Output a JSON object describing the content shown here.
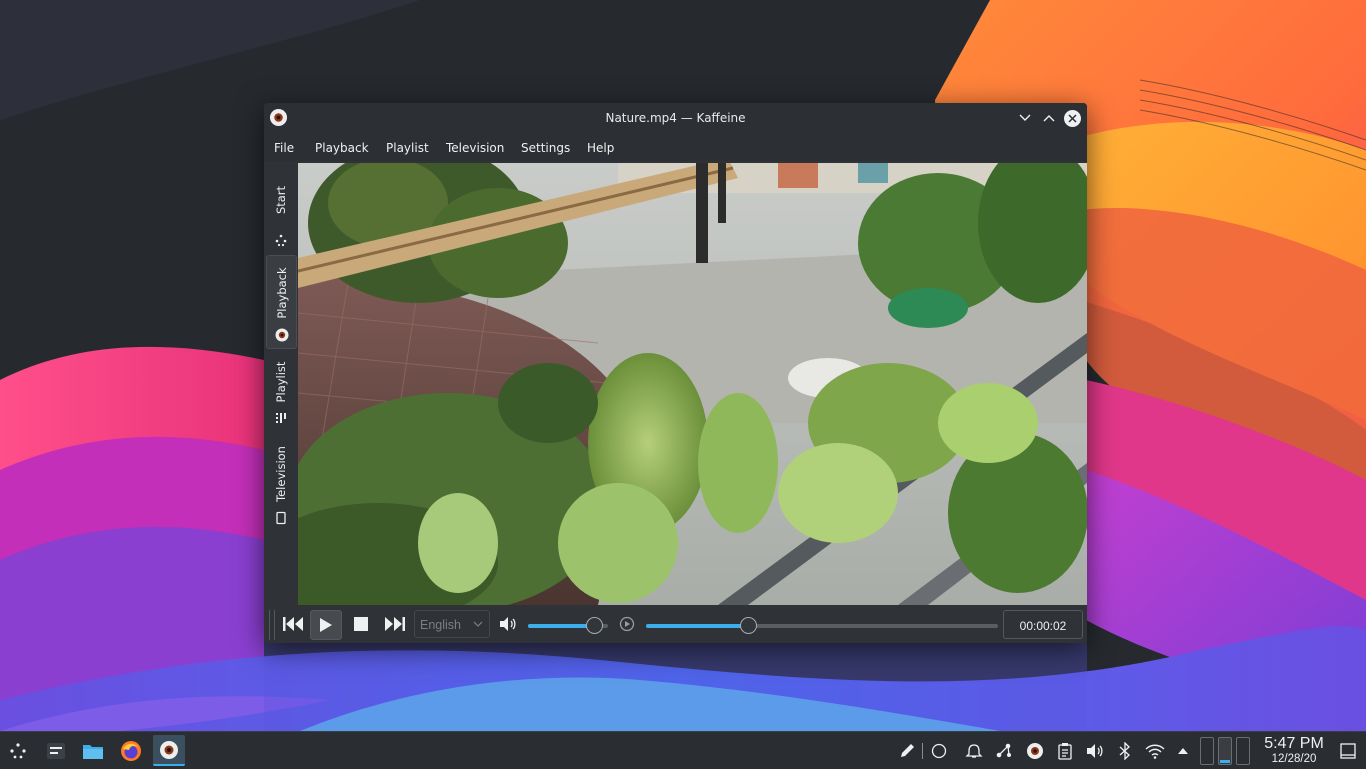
{
  "window": {
    "title": "Nature.mp4 — Kaffeine",
    "menu": [
      "File",
      "Playback",
      "Playlist",
      "Television",
      "Settings",
      "Help"
    ],
    "side_tabs": [
      {
        "label": "Start",
        "icon": "start-icon"
      },
      {
        "label": "Playback",
        "icon": "kaffeine-icon",
        "active": true
      },
      {
        "label": "Playlist",
        "icon": "playlist-icon"
      },
      {
        "label": "Television",
        "icon": "tv-icon"
      }
    ]
  },
  "controls": {
    "audio_language": "English",
    "volume_level": 0.83,
    "seek_position": 0.29,
    "time": "00:00:02"
  },
  "taskbar": {
    "clock_time": "5:47 PM",
    "clock_date": "12/28/20"
  },
  "colors": {
    "accent": "#3daee9",
    "window_bg": "#2f3236",
    "taskbar_bg": "#2a2e32"
  }
}
